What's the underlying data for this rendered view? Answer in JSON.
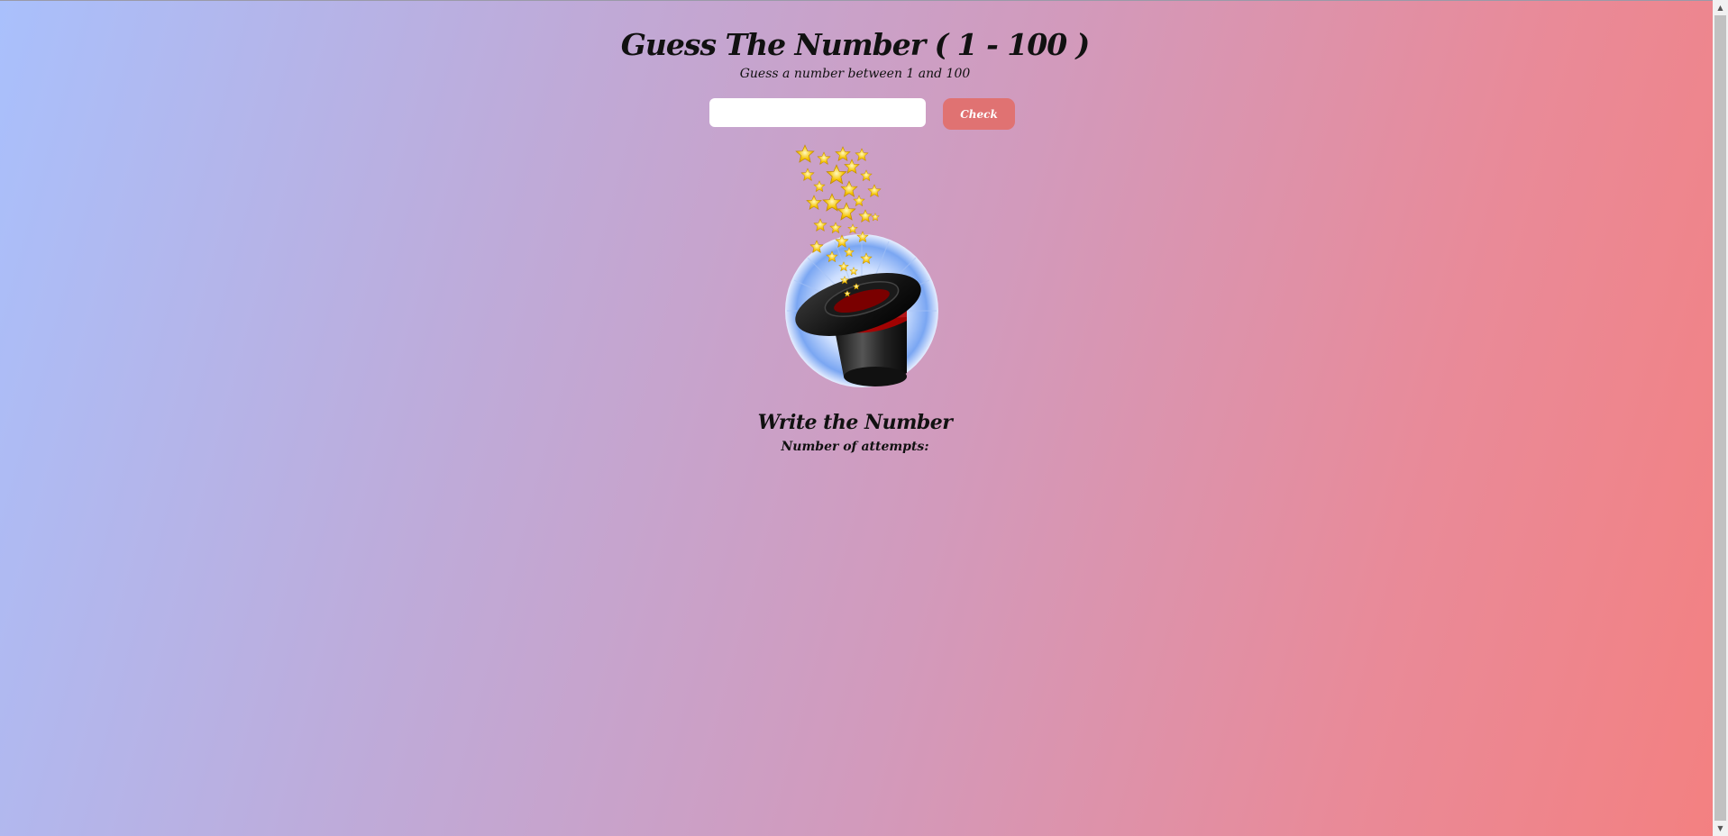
{
  "header": {
    "title": "Guess The Number ( 1 - 100 )",
    "subtitle": "Guess a number between 1 and 100"
  },
  "form": {
    "input_value": "",
    "input_placeholder": "",
    "check_label": "Check"
  },
  "result": {
    "message": "Write the Number",
    "attempts_label": "Number of attempts:"
  },
  "image": {
    "icon": "magic-hat-with-stars"
  },
  "scrollbar": {
    "up_icon": "▲",
    "down_icon": "▼"
  },
  "colors": {
    "check_button": "#e07272",
    "gradient_start": "#a9c0fc",
    "gradient_end": "#f48080"
  }
}
